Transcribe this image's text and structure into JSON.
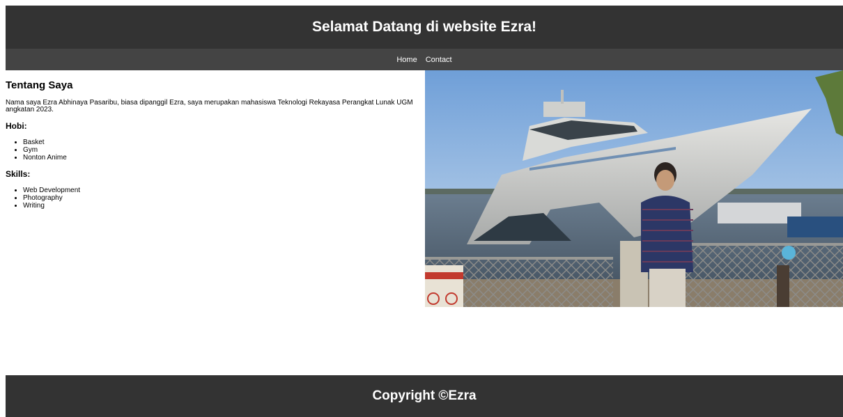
{
  "header": {
    "title": "Selamat Datang di website Ezra!"
  },
  "nav": {
    "items": [
      {
        "label": "Home"
      },
      {
        "label": "Contact"
      }
    ]
  },
  "about": {
    "title": "Tentang Saya",
    "description": "Nama saya Ezra Abhinaya Pasaribu, biasa dipanggil Ezra, saya merupakan mahasiswa Teknologi Rekayasa Perangkat Lunak UGM angkatan 2023.",
    "hobbies_title": "Hobi:",
    "hobbies": [
      "Basket",
      "Gym",
      "Nonton Anime"
    ],
    "skills_title": "Skills:",
    "skills": [
      "Web Development",
      "Photography",
      "Writing"
    ]
  },
  "photo": {
    "subject": "person-standing-in-front-of-yacht"
  },
  "footer": {
    "copyright": "Copyright ©Ezra"
  },
  "colors": {
    "header_bg": "#333333",
    "nav_bg": "#444444",
    "footer_bg": "#333333",
    "text_light": "#ffffff"
  }
}
